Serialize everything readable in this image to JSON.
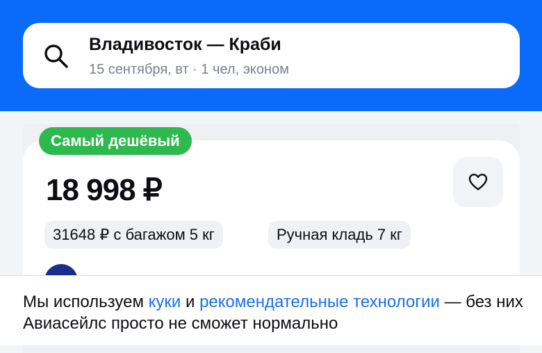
{
  "search": {
    "route": "Владивосток — Краби",
    "details": "15 сентября, вт · 1 чел, эконом",
    "icon": "search-icon"
  },
  "offer": {
    "badge": "Самый дешёвый",
    "price": "18 998 ₽",
    "favorite_icon": "heart-icon",
    "chips": [
      "31648 ₽ с багажом 5 кг",
      "Ручная кладь 7 кг"
    ]
  },
  "cookie_notice": {
    "text_before": "Мы используем ",
    "link_cookies": "куки",
    "text_and": " и ",
    "link_recommend": "рекомендательные технологии",
    "text_after": " — без них Авиасейлс просто не сможет нормально"
  },
  "colors": {
    "brand_blue": "#0a6bfa",
    "badge_green": "#2db94d",
    "link_blue": "#1a6fe8"
  }
}
